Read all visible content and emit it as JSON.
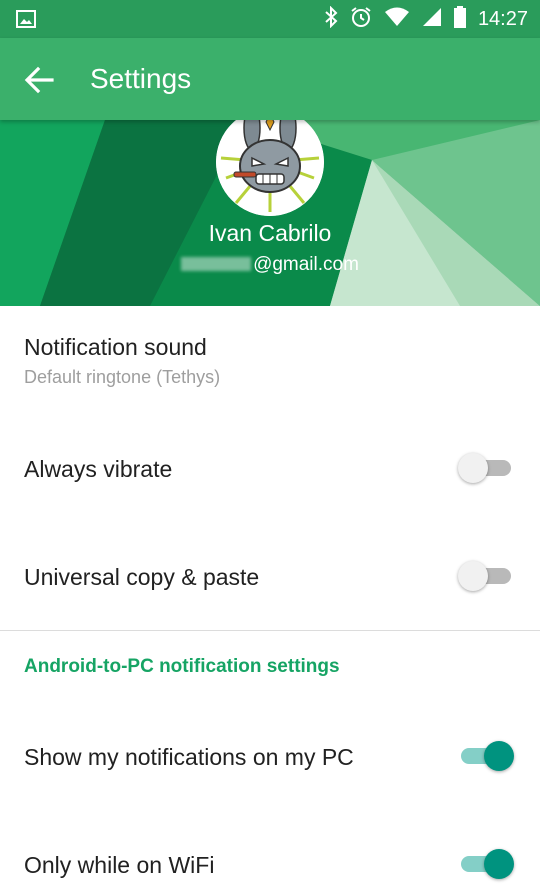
{
  "status_bar": {
    "time": "14:27",
    "left_icon": "image-icon",
    "icons": [
      "bluetooth-icon",
      "alarm-icon",
      "wifi-icon",
      "signal-icon",
      "battery-icon"
    ],
    "color": "#2a9c5b"
  },
  "app_bar": {
    "title": "Settings",
    "back_icon": "arrow-back-icon",
    "color": "#3bb06b"
  },
  "profile": {
    "name": "Ivan Cabrilo",
    "email_visible": "@gmail.com",
    "avatar_icon": "rabbit-avatar-icon"
  },
  "settings": {
    "notification_sound": {
      "title": "Notification sound",
      "subtitle": "Default ringtone (Tethys)"
    },
    "always_vibrate": {
      "title": "Always vibrate",
      "enabled": false
    },
    "universal_copy": {
      "title": "Universal copy & paste",
      "enabled": false
    }
  },
  "section": {
    "title": "Android-to-PC notification settings",
    "color": "#16a464"
  },
  "pc_settings": {
    "show_notifications": {
      "title": "Show my notifications on my PC",
      "enabled": true
    },
    "only_wifi": {
      "title": "Only while on WiFi",
      "enabled": true
    }
  },
  "colors": {
    "toggle_on": "#00937f",
    "toggle_off": "#f1f1f1"
  }
}
